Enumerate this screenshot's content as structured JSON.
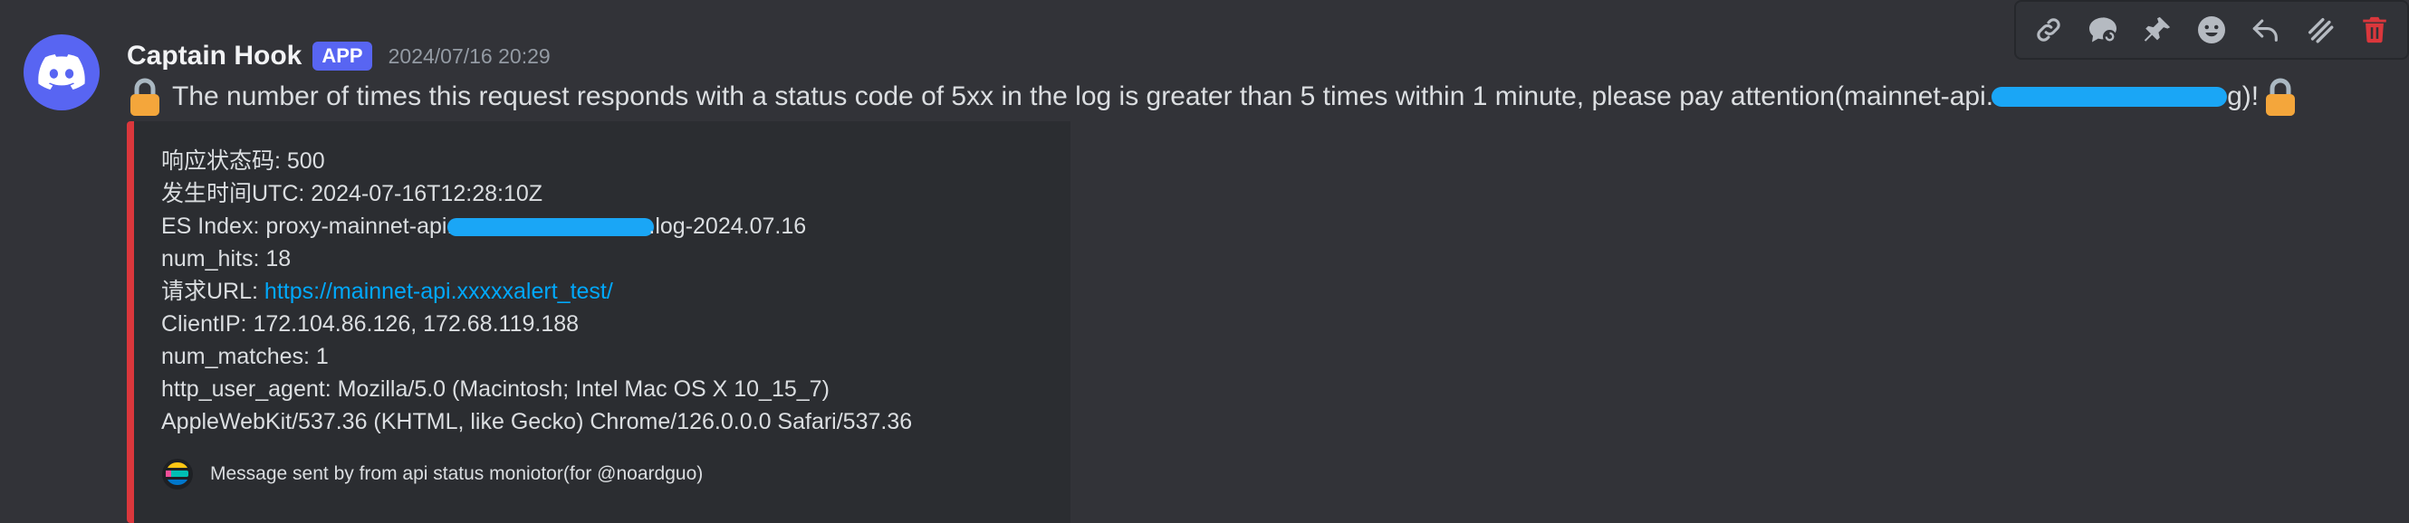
{
  "message": {
    "author": "Captain Hook",
    "badge": "APP",
    "timestamp": "2024/07/16 20:29",
    "text_before": "The number of times this request responds with a status code of 5xx in the log is greater than 5 times within 1 minute, please pay attention(mainnet-api.",
    "text_after": "g)!"
  },
  "embed": {
    "accent_color": "#da373c",
    "fields": [
      {
        "label": "响应状态码",
        "value": ": 500"
      },
      {
        "label": "发生时间UTC",
        "value": ": 2024-07-16T12:28:10Z"
      },
      {
        "label": "ES Index",
        "value_prefix": ": proxy-mainnet-api.",
        "value_suffix": ".log-2024.07.16"
      },
      {
        "label": "num_hits",
        "value": ": 18"
      },
      {
        "label": "请求URL",
        "sep": ": ",
        "link": "https://mainnet-api.xxxxxalert_test/"
      },
      {
        "label": "ClientIP",
        "value": ": 172.104.86.126, 172.68.119.188"
      },
      {
        "label": "num_matches",
        "value": ": 1"
      },
      {
        "label": "http_user_agent",
        "value": ": Mozilla/5.0 (Macintosh; Intel Mac OS X 10_15_7)"
      },
      {
        "continuation": "AppleWebKit/537.36 (KHTML, like Gecko) Chrome/126.0.0.0 Safari/537.36"
      }
    ],
    "footer": "Message sent by from api status moniotor(for @noardguo)"
  },
  "toolbar": {
    "icons": [
      "link-icon",
      "thread-icon",
      "pin-icon",
      "emoji-icon",
      "reply-icon",
      "apps-icon",
      "delete-icon"
    ]
  },
  "colors": {
    "background": "#323338",
    "embed_bg": "#2b2d31",
    "blurple": "#5865f2",
    "link": "#00a8fc",
    "danger": "#da373c",
    "redaction": "#1aa6f6"
  }
}
